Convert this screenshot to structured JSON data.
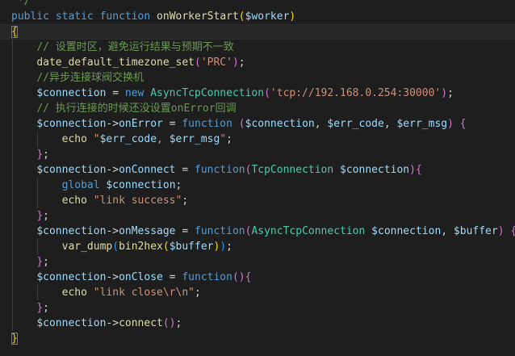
{
  "editor": {
    "colors": {
      "background": "#1e1e1e",
      "keyword": "#569cd6",
      "function": "#dcdcaa",
      "variable": "#9cdcfe",
      "string": "#ce9178",
      "comment": "#6a9955",
      "class": "#4ec9b0",
      "plain": "#d4d4d4",
      "brace": "#ffd700",
      "paren": "#da70d6",
      "bracket2": "#179fff"
    },
    "lines": [
      [
        {
          "t": " */",
          "c": "comment"
        }
      ],
      [
        {
          "t": "public",
          "c": "keyword"
        },
        {
          "t": " ",
          "c": "plain"
        },
        {
          "t": "static",
          "c": "keyword"
        },
        {
          "t": " ",
          "c": "plain"
        },
        {
          "t": "function",
          "c": "keyword"
        },
        {
          "t": " ",
          "c": "plain"
        },
        {
          "t": "onWorkerStart",
          "c": "function"
        },
        {
          "t": "(",
          "c": "brace"
        },
        {
          "t": "$worker",
          "c": "variable"
        },
        {
          "t": ")",
          "c": "brace"
        }
      ],
      [
        {
          "t": "{",
          "c": "brace",
          "box": true
        }
      ],
      [
        {
          "t": "    ",
          "c": "plain"
        },
        {
          "t": "// 设置时区，避免运行结果与预期不一致",
          "c": "comment"
        }
      ],
      [
        {
          "t": "    ",
          "c": "plain"
        },
        {
          "t": "date_default_timezone_set",
          "c": "function"
        },
        {
          "t": "(",
          "c": "paren"
        },
        {
          "t": "'PRC'",
          "c": "string"
        },
        {
          "t": ")",
          "c": "paren"
        },
        {
          "t": ";",
          "c": "plain"
        }
      ],
      [
        {
          "t": "    ",
          "c": "plain"
        },
        {
          "t": "//异步连接球阀交换机",
          "c": "comment"
        }
      ],
      [
        {
          "t": "    ",
          "c": "plain"
        },
        {
          "t": "$connection",
          "c": "variable"
        },
        {
          "t": " = ",
          "c": "plain"
        },
        {
          "t": "new",
          "c": "keyword"
        },
        {
          "t": " ",
          "c": "plain"
        },
        {
          "t": "AsyncTcpConnection",
          "c": "class"
        },
        {
          "t": "(",
          "c": "paren"
        },
        {
          "t": "'tcp://192.168.0.254:30000'",
          "c": "string"
        },
        {
          "t": ")",
          "c": "paren"
        },
        {
          "t": ";",
          "c": "plain"
        }
      ],
      [
        {
          "t": "    ",
          "c": "plain"
        },
        {
          "t": "// 执行连接的时候还没设置onError回调",
          "c": "comment"
        }
      ],
      [
        {
          "t": "    ",
          "c": "plain"
        },
        {
          "t": "$connection",
          "c": "variable"
        },
        {
          "t": "->",
          "c": "plain"
        },
        {
          "t": "onError",
          "c": "variable"
        },
        {
          "t": " = ",
          "c": "plain"
        },
        {
          "t": "function",
          "c": "keyword"
        },
        {
          "t": " ",
          "c": "plain"
        },
        {
          "t": "(",
          "c": "paren"
        },
        {
          "t": "$connection",
          "c": "variable"
        },
        {
          "t": ", ",
          "c": "plain"
        },
        {
          "t": "$err_code",
          "c": "variable"
        },
        {
          "t": ", ",
          "c": "plain"
        },
        {
          "t": "$err_msg",
          "c": "variable"
        },
        {
          "t": ")",
          "c": "paren"
        },
        {
          "t": " ",
          "c": "plain"
        },
        {
          "t": "{",
          "c": "paren"
        }
      ],
      [
        {
          "t": "        ",
          "c": "plain"
        },
        {
          "t": "echo",
          "c": "function"
        },
        {
          "t": " ",
          "c": "plain"
        },
        {
          "t": "\"",
          "c": "string"
        },
        {
          "t": "$err_code",
          "c": "variable"
        },
        {
          "t": ", ",
          "c": "string"
        },
        {
          "t": "$err_msg",
          "c": "variable"
        },
        {
          "t": "\"",
          "c": "string"
        },
        {
          "t": ";",
          "c": "plain"
        }
      ],
      [
        {
          "t": "    ",
          "c": "plain"
        },
        {
          "t": "}",
          "c": "paren"
        },
        {
          "t": ";",
          "c": "plain"
        }
      ],
      [
        {
          "t": "    ",
          "c": "plain"
        },
        {
          "t": "$connection",
          "c": "variable"
        },
        {
          "t": "->",
          "c": "plain"
        },
        {
          "t": "onConnect",
          "c": "variable"
        },
        {
          "t": " = ",
          "c": "plain"
        },
        {
          "t": "function",
          "c": "keyword"
        },
        {
          "t": "(",
          "c": "paren"
        },
        {
          "t": "TcpConnection",
          "c": "class"
        },
        {
          "t": " ",
          "c": "plain"
        },
        {
          "t": "$connection",
          "c": "variable"
        },
        {
          "t": ")",
          "c": "paren"
        },
        {
          "t": "{",
          "c": "paren"
        }
      ],
      [
        {
          "t": "        ",
          "c": "plain"
        },
        {
          "t": "global",
          "c": "keyword"
        },
        {
          "t": " ",
          "c": "plain"
        },
        {
          "t": "$connection",
          "c": "variable"
        },
        {
          "t": ";",
          "c": "plain"
        }
      ],
      [
        {
          "t": "        ",
          "c": "plain"
        },
        {
          "t": "echo",
          "c": "function"
        },
        {
          "t": " ",
          "c": "plain"
        },
        {
          "t": "\"link success\"",
          "c": "string"
        },
        {
          "t": ";",
          "c": "plain"
        }
      ],
      [
        {
          "t": "    ",
          "c": "plain"
        },
        {
          "t": "}",
          "c": "paren"
        },
        {
          "t": ";",
          "c": "plain"
        }
      ],
      [
        {
          "t": "    ",
          "c": "plain"
        },
        {
          "t": "$connection",
          "c": "variable"
        },
        {
          "t": "->",
          "c": "plain"
        },
        {
          "t": "onMessage",
          "c": "variable"
        },
        {
          "t": " = ",
          "c": "plain"
        },
        {
          "t": "function",
          "c": "keyword"
        },
        {
          "t": "(",
          "c": "paren"
        },
        {
          "t": "AsyncTcpConnection",
          "c": "class"
        },
        {
          "t": " ",
          "c": "plain"
        },
        {
          "t": "$connection",
          "c": "variable"
        },
        {
          "t": ", ",
          "c": "plain"
        },
        {
          "t": "$buffer",
          "c": "variable"
        },
        {
          "t": ")",
          "c": "paren"
        },
        {
          "t": " ",
          "c": "plain"
        },
        {
          "t": "{",
          "c": "paren"
        }
      ],
      [
        {
          "t": "        ",
          "c": "plain"
        },
        {
          "t": "var_dump",
          "c": "function"
        },
        {
          "t": "(",
          "c": "bracket2"
        },
        {
          "t": "bin2hex",
          "c": "function"
        },
        {
          "t": "(",
          "c": "brace"
        },
        {
          "t": "$buffer",
          "c": "variable"
        },
        {
          "t": ")",
          "c": "brace"
        },
        {
          "t": ")",
          "c": "bracket2"
        },
        {
          "t": ";",
          "c": "plain"
        }
      ],
      [
        {
          "t": "    ",
          "c": "plain"
        },
        {
          "t": "}",
          "c": "paren"
        },
        {
          "t": ";",
          "c": "plain"
        }
      ],
      [
        {
          "t": "    ",
          "c": "plain"
        },
        {
          "t": "$connection",
          "c": "variable"
        },
        {
          "t": "->",
          "c": "plain"
        },
        {
          "t": "onClose",
          "c": "variable"
        },
        {
          "t": " = ",
          "c": "plain"
        },
        {
          "t": "function",
          "c": "keyword"
        },
        {
          "t": "(",
          "c": "paren"
        },
        {
          "t": ")",
          "c": "paren"
        },
        {
          "t": "{",
          "c": "paren"
        }
      ],
      [
        {
          "t": "        ",
          "c": "plain"
        },
        {
          "t": "echo",
          "c": "function"
        },
        {
          "t": " ",
          "c": "plain"
        },
        {
          "t": "\"link close\\r\\n\"",
          "c": "string"
        },
        {
          "t": ";",
          "c": "plain"
        }
      ],
      [
        {
          "t": "    ",
          "c": "plain"
        },
        {
          "t": "}",
          "c": "paren"
        },
        {
          "t": ";",
          "c": "plain"
        }
      ],
      [
        {
          "t": "    ",
          "c": "plain"
        },
        {
          "t": "$connection",
          "c": "variable"
        },
        {
          "t": "->",
          "c": "plain"
        },
        {
          "t": "connect",
          "c": "function"
        },
        {
          "t": "(",
          "c": "paren"
        },
        {
          "t": ")",
          "c": "paren"
        },
        {
          "t": ";",
          "c": "plain"
        }
      ],
      [
        {
          "t": "}",
          "c": "brace",
          "box": true
        }
      ]
    ]
  }
}
